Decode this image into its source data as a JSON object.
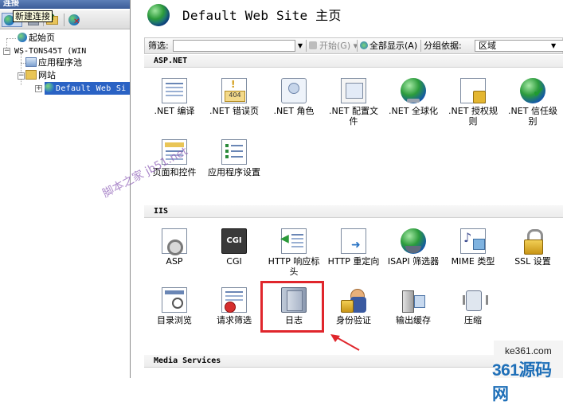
{
  "connections": {
    "header": "连接",
    "tooltip": "新建连接",
    "tree": {
      "start_page": "起始页",
      "server": "WS-TONS45T (WIN",
      "app_pools": "应用程序池",
      "sites": "网站",
      "default_site": "Default Web Si"
    }
  },
  "page": {
    "title": "Default Web Site 主页"
  },
  "filterbar": {
    "filter_label": "筛选:",
    "start_label": "开始(G)",
    "show_all_label": "全部显示(A)",
    "group_by_label": "分组依据:",
    "group_by_value": "区域"
  },
  "sections": {
    "aspnet": {
      "title": "ASP.NET",
      "items": [
        ".NET 编译",
        ".NET 错误页",
        ".NET 角色",
        ".NET 配置文件",
        ".NET 全球化",
        ".NET 授权规则",
        ".NET 信任级别",
        "页面和控件",
        "应用程序设置"
      ]
    },
    "iis": {
      "title": "IIS",
      "items": [
        "ASP",
        "CGI",
        "HTTP 响应标头",
        "HTTP 重定向",
        "ISAPI 筛选器",
        "MIME 类型",
        "SSL 设置",
        "目录浏览",
        "请求筛选",
        "日志",
        "身份验证",
        "输出缓存",
        "压缩"
      ]
    },
    "media": {
      "title": "Media Services"
    }
  },
  "watermark": "脚本之家 jb51.net",
  "branding": {
    "url": "ke361.com",
    "name": "361源码网"
  },
  "colors": {
    "highlight": "#e0262c",
    "selection": "#2a62c4"
  }
}
